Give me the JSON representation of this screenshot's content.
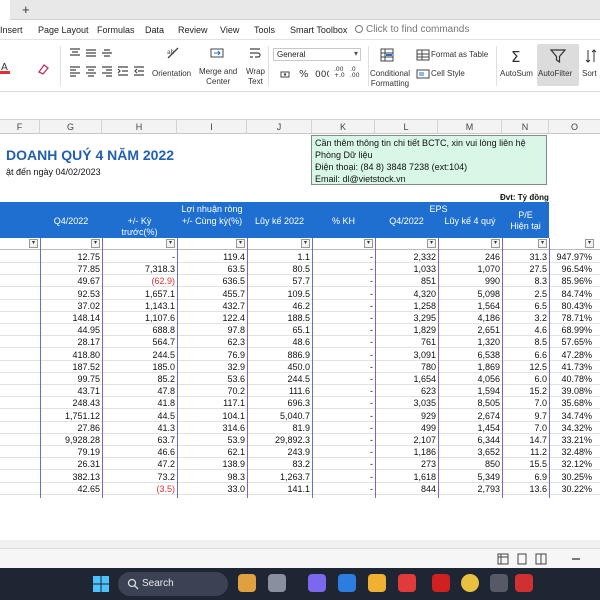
{
  "menu": [
    "Insert",
    "Page Layout",
    "Formulas",
    "Data",
    "Review",
    "View",
    "Tools",
    "Smart Toolbox"
  ],
  "search_commands": "Click to find commands",
  "toolbar": {
    "orientation": "Orientation",
    "merge": "Merge and",
    "merge2": "Center",
    "wrap": "Wrap",
    "wrap2": "Text",
    "number_format": "General",
    "format_table": "Format as Table",
    "cell_style": "Cell Style",
    "conditional": "Conditional",
    "conditional2": "Formatting",
    "autosum": "AutoSum",
    "autofilter": "AutoFilter",
    "sort": "Sort"
  },
  "columns": [
    "F",
    "G",
    "H",
    "I",
    "J",
    "K",
    "L",
    "M",
    "N",
    "O"
  ],
  "sheet": {
    "title": "DOANH QUÝ 4 NĂM 2022",
    "subtitle": "ật đến ngày 04/02/2023",
    "note_lines": [
      "Cần thêm thông tin chi tiết BCTC, xin vui lòng liên hệ",
      "Phòng Dữ liệu",
      "Điện thoại: (84 8)  3848 7238 (ext:104)",
      "Email: dl@vietstock.vn"
    ],
    "unit": "Đvt: Tỷ đồng",
    "group_profit": "Lợi nhuận ròng",
    "group_eps": "EPS",
    "headers": {
      "q4": "Q4/2022",
      "chg1": "+/- Kỳ",
      "chg1b": "trước(%)",
      "chg2": "+/- Cùng kỳ(%)",
      "ytd": "Lũy kế 2022",
      "plan": "% KH",
      "eps_q4": "Q4/2022",
      "eps_4q": "Lũy kế 4 quý",
      "pe": "P/E",
      "pe2": "Hiện tại"
    },
    "rows": [
      [
        "12.75",
        "-",
        "119.4",
        "1.1",
        "-",
        "2,332",
        "246",
        "31.3",
        "947.97%"
      ],
      [
        "77.85",
        "7,318.3",
        "63.5",
        "80.5",
        "-",
        "1,033",
        "1,070",
        "27.5",
        "96.54%"
      ],
      [
        "49.67",
        "(62.9)",
        "636.5",
        "57.7",
        "-",
        "851",
        "990",
        "8.3",
        "85.96%"
      ],
      [
        "92.53",
        "1,657.1",
        "455.7",
        "109.5",
        "-",
        "4,320",
        "5,098",
        "2.5",
        "84.74%"
      ],
      [
        "37.02",
        "1,143.1",
        "432.7",
        "46.2",
        "-",
        "1,258",
        "1,564",
        "6.5",
        "80.43%"
      ],
      [
        "148.14",
        "1,107.6",
        "122.4",
        "188.5",
        "-",
        "3,295",
        "4,186",
        "3.2",
        "78.71%"
      ],
      [
        "44.95",
        "688.8",
        "97.8",
        "65.1",
        "-",
        "1,829",
        "2,651",
        "4.6",
        "68.99%"
      ],
      [
        "28.17",
        "564.7",
        "62.3",
        "48.6",
        "-",
        "761",
        "1,320",
        "8.5",
        "57.65%"
      ],
      [
        "418.80",
        "244.5",
        "76.9",
        "886.9",
        "-",
        "3,091",
        "6,538",
        "6.6",
        "47.28%"
      ],
      [
        "187.52",
        "185.0",
        "32.9",
        "450.0",
        "-",
        "780",
        "1,869",
        "12.5",
        "41.73%"
      ],
      [
        "99.75",
        "85.2",
        "53.6",
        "244.5",
        "-",
        "1,654",
        "4,056",
        "6.0",
        "40.78%"
      ],
      [
        "43.71",
        "47.8",
        "70.2",
        "111.6",
        "-",
        "623",
        "1,594",
        "15.2",
        "39.08%"
      ],
      [
        "248.43",
        "41.8",
        "117.1",
        "696.3",
        "-",
        "3,035",
        "8,505",
        "7.0",
        "35.68%"
      ],
      [
        "1,751.12",
        "44.5",
        "104.1",
        "5,040.7",
        "-",
        "929",
        "2,674",
        "9.7",
        "34.74%"
      ],
      [
        "27.86",
        "41.3",
        "314.6",
        "81.9",
        "-",
        "499",
        "1,454",
        "7.0",
        "34.32%"
      ],
      [
        "9,928.28",
        "63.7",
        "53.9",
        "29,892.3",
        "-",
        "2,107",
        "6,344",
        "14.7",
        "33.21%"
      ],
      [
        "79.19",
        "46.6",
        "62.1",
        "243.9",
        "-",
        "1,186",
        "3,652",
        "11.2",
        "32.48%"
      ],
      [
        "26.31",
        "47.2",
        "138.9",
        "83.2",
        "-",
        "273",
        "850",
        "15.5",
        "32.12%"
      ],
      [
        "382.13",
        "73.2",
        "98.3",
        "1,263.7",
        "-",
        "1,618",
        "5,349",
        "6.9",
        "30.25%"
      ],
      [
        "42.65",
        "(3.5)",
        "33.0",
        "141.1",
        "-",
        "844",
        "2,793",
        "13.6",
        "30.22%"
      ]
    ]
  },
  "taskbar": {
    "search": "Search"
  },
  "colors": {
    "header_blue": "#1f6fd1",
    "title_blue": "#1f5fb5",
    "note_bg": "#d9f7e6",
    "negative": "#e03030"
  }
}
